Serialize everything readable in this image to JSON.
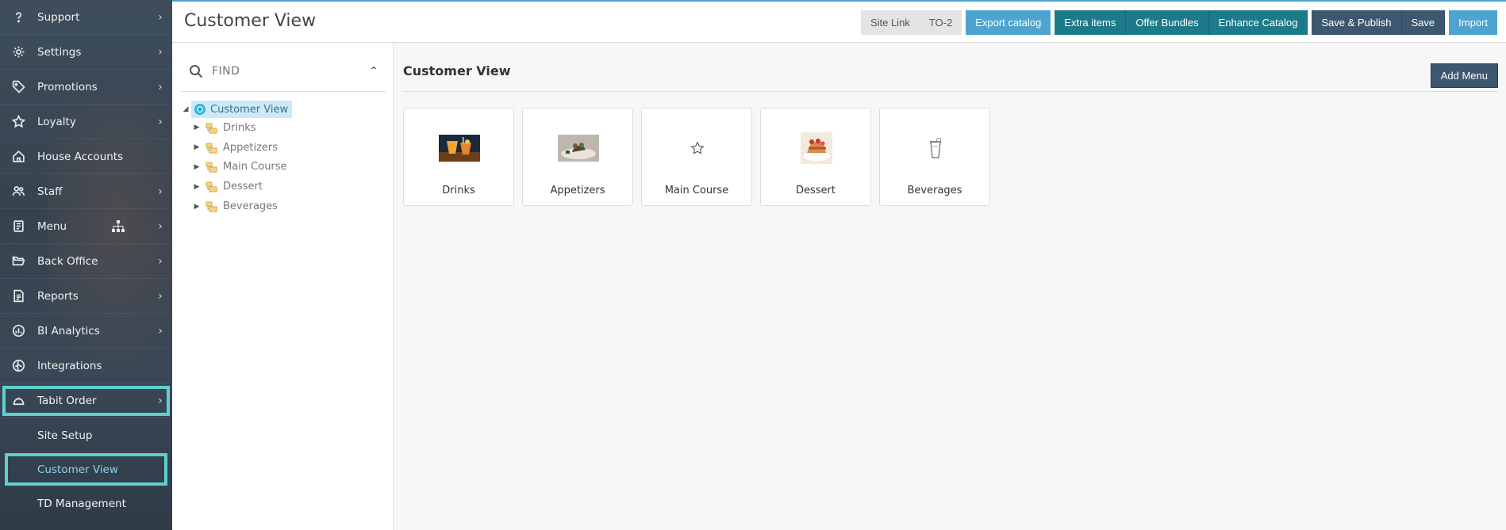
{
  "header": {
    "title": "Customer View",
    "buttons": {
      "site_link": "Site Link",
      "to2": "TO-2",
      "export_catalog": "Export catalog",
      "extra_items": "Extra items",
      "offer_bundles": "Offer Bundles",
      "enhance_catalog": "Enhance Catalog",
      "save_publish": "Save & Publish",
      "save": "Save",
      "import": "Import"
    }
  },
  "sidebar": {
    "items": [
      {
        "label": "Support",
        "icon": "question-icon"
      },
      {
        "label": "Settings",
        "icon": "gear-icon"
      },
      {
        "label": "Promotions",
        "icon": "tag-icon"
      },
      {
        "label": "Loyalty",
        "icon": "star-icon"
      },
      {
        "label": "House Accounts",
        "icon": "house-icon"
      },
      {
        "label": "Staff",
        "icon": "people-icon"
      },
      {
        "label": "Menu",
        "icon": "menu-book-icon"
      },
      {
        "label": "Back Office",
        "icon": "folder-open-icon"
      },
      {
        "label": "Reports",
        "icon": "document-icon"
      },
      {
        "label": "BI Analytics",
        "icon": "chart-icon"
      },
      {
        "label": "Integrations",
        "icon": "integrations-icon"
      },
      {
        "label": "Tabit Order",
        "icon": "cloche-icon"
      }
    ],
    "sub_items": [
      "Site Setup",
      "Customer View",
      "TD Management"
    ]
  },
  "tree": {
    "search_placeholder": "FIND",
    "root": "Customer View",
    "children": [
      "Drinks",
      "Appetizers",
      "Main Course",
      "Dessert",
      "Beverages"
    ]
  },
  "main": {
    "title": "Customer View",
    "add_menu": "Add Menu",
    "cards": [
      "Drinks",
      "Appetizers",
      "Main Course",
      "Dessert",
      "Beverages"
    ]
  },
  "colors": {
    "accent": "#4fa3d1",
    "teal": "#1c7a8a",
    "dark": "#3e5770",
    "highlight": "#5ed1cf"
  }
}
